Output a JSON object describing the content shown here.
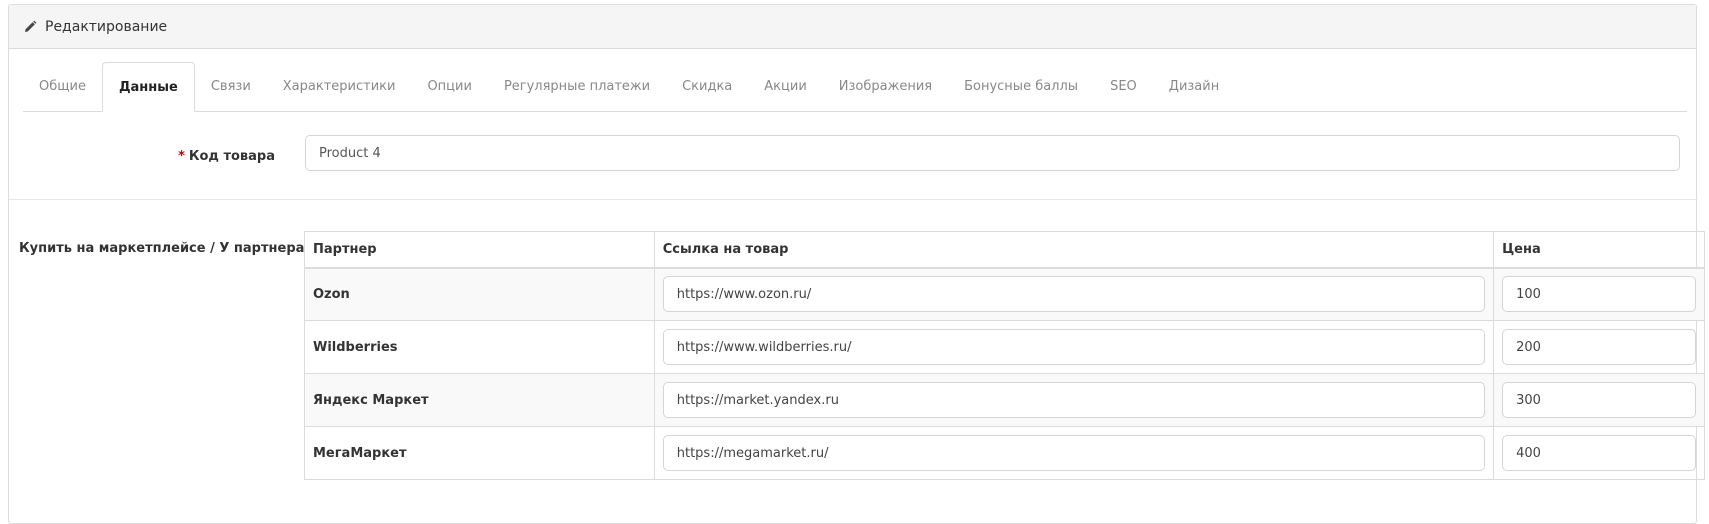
{
  "panel": {
    "title": "Редактирование",
    "title_icon": "pencil-icon"
  },
  "tabs": [
    {
      "label": "Общие",
      "active": false
    },
    {
      "label": "Данные",
      "active": true
    },
    {
      "label": "Связи",
      "active": false
    },
    {
      "label": "Характеристики",
      "active": false
    },
    {
      "label": "Опции",
      "active": false
    },
    {
      "label": "Регулярные платежи",
      "active": false
    },
    {
      "label": "Скидка",
      "active": false
    },
    {
      "label": "Акции",
      "active": false
    },
    {
      "label": "Изображения",
      "active": false
    },
    {
      "label": "Бонусные баллы",
      "active": false
    },
    {
      "label": "SEO",
      "active": false
    },
    {
      "label": "Дизайн",
      "active": false
    }
  ],
  "product_code": {
    "required_mark": "*",
    "label": "Код товара",
    "value": "Product 4"
  },
  "marketplace": {
    "label": "Купить на маркетплейсе / У партнера",
    "columns": {
      "partner": "Партнер",
      "link": "Ссылка на товар",
      "price": "Цена"
    },
    "rows": [
      {
        "partner": "Ozon",
        "link": "https://www.ozon.ru/",
        "price": "100"
      },
      {
        "partner": "Wildberries",
        "link": "https://www.wildberries.ru/",
        "price": "200"
      },
      {
        "partner": "Яндекс Маркет",
        "link": "https://market.yandex.ru",
        "price": "300"
      },
      {
        "partner": "МегаМаркет",
        "link": "https://megamarket.ru/",
        "price": "400"
      }
    ]
  }
}
